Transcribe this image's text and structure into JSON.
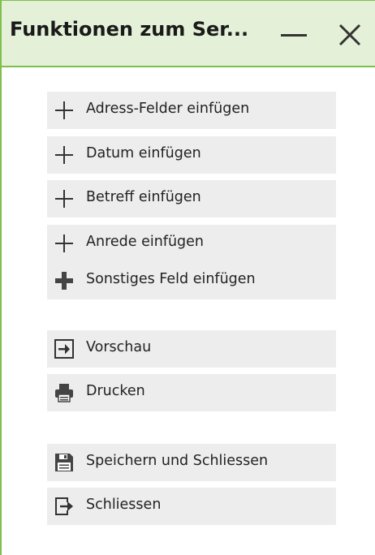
{
  "panel": {
    "title": "Funktionen zum Ser...",
    "minimize_icon": "minimize-icon",
    "close_icon": "close-icon"
  },
  "insert_actions": [
    {
      "label": "Adress-Felder einfügen",
      "icon": "plus-icon"
    },
    {
      "label": "Datum einfügen",
      "icon": "plus-icon"
    },
    {
      "label": "Betreff einfügen",
      "icon": "plus-icon"
    },
    {
      "label": "Anrede einfügen",
      "icon": "plus-icon"
    },
    {
      "label": "Sonstiges Feld einfügen",
      "icon": "plus-bold-icon"
    }
  ],
  "output_actions": [
    {
      "label": "Vorschau",
      "icon": "preview-arrow-icon"
    },
    {
      "label": "Drucken",
      "icon": "printer-icon"
    }
  ],
  "close_actions": [
    {
      "label": "Speichern und Schliessen",
      "icon": "save-icon"
    },
    {
      "label": "Schliessen",
      "icon": "exit-icon"
    }
  ],
  "colors": {
    "header_bg": "#e4f1d8",
    "accent_green": "#7fbf4d",
    "button_bg": "#ededed",
    "text": "#222222"
  }
}
